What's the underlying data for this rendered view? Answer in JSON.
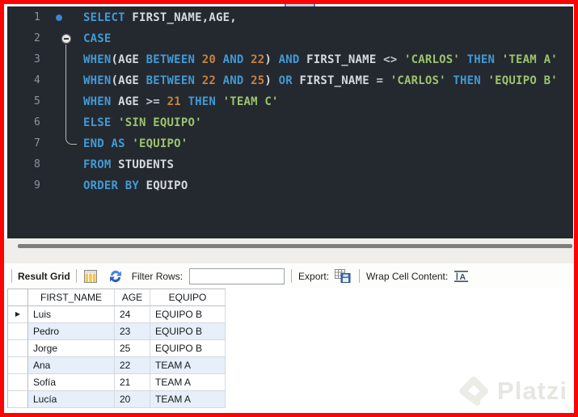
{
  "editor": {
    "background": "#24282f",
    "syntax_colors": {
      "k": "#419bd5",
      "i": "#d6dade",
      "n": "#c8823f",
      "s": "#9bc46d",
      "o": "#c2c8cf"
    },
    "lines": [
      {
        "num": "1",
        "marker": "statement",
        "tokens": [
          [
            "SELECT ",
            "k"
          ],
          [
            "FIRST_NAME,AGE,",
            "i"
          ]
        ]
      },
      {
        "num": "2",
        "marker": "fold",
        "tokens": [
          [
            "CASE",
            "k"
          ]
        ]
      },
      {
        "num": "3",
        "marker": "",
        "tokens": [
          [
            "WHEN",
            "k"
          ],
          [
            "(AGE ",
            "i"
          ],
          [
            "BETWEEN ",
            "k"
          ],
          [
            "20 ",
            "n"
          ],
          [
            "AND ",
            "k"
          ],
          [
            "22",
            "n"
          ],
          [
            ") ",
            "i"
          ],
          [
            "AND ",
            "k"
          ],
          [
            "FIRST_NAME ",
            "i"
          ],
          [
            "<> ",
            "o"
          ],
          [
            "'CARLOS' ",
            "s"
          ],
          [
            "THEN ",
            "k"
          ],
          [
            "'TEAM A'",
            "s"
          ]
        ]
      },
      {
        "num": "4",
        "marker": "",
        "tokens": [
          [
            "WHEN",
            "k"
          ],
          [
            "(AGE ",
            "i"
          ],
          [
            "BETWEEN ",
            "k"
          ],
          [
            "22 ",
            "n"
          ],
          [
            "AND ",
            "k"
          ],
          [
            "25",
            "n"
          ],
          [
            ") ",
            "i"
          ],
          [
            "OR ",
            "k"
          ],
          [
            "FIRST_NAME ",
            "i"
          ],
          [
            "= ",
            "o"
          ],
          [
            "'CARLOS' ",
            "s"
          ],
          [
            "THEN ",
            "k"
          ],
          [
            "'EQUIPO B'",
            "s"
          ]
        ]
      },
      {
        "num": "5",
        "marker": "",
        "tokens": [
          [
            "WHEN ",
            "k"
          ],
          [
            "AGE ",
            "i"
          ],
          [
            ">= ",
            "o"
          ],
          [
            "21 ",
            "n"
          ],
          [
            "THEN ",
            "k"
          ],
          [
            "'TEAM C'",
            "s"
          ]
        ]
      },
      {
        "num": "6",
        "marker": "",
        "tokens": [
          [
            "ELSE ",
            "k"
          ],
          [
            "'SIN EQUIPO'",
            "s"
          ]
        ]
      },
      {
        "num": "7",
        "marker": "",
        "tokens": [
          [
            "END AS ",
            "k"
          ],
          [
            "'EQUIPO'",
            "s"
          ]
        ]
      },
      {
        "num": "8",
        "marker": "",
        "tokens": [
          [
            "FROM ",
            "k"
          ],
          [
            "STUDENTS",
            "i"
          ]
        ]
      },
      {
        "num": "9",
        "marker": "",
        "tokens": [
          [
            "ORDER BY ",
            "k"
          ],
          [
            "EQUIPO",
            "i"
          ]
        ]
      }
    ]
  },
  "results_toolbar": {
    "result_grid_label": "Result Grid",
    "filter_rows_label": "Filter Rows:",
    "filter_input_value": "",
    "export_label": "Export:",
    "wrap_cell_label": "Wrap Cell Content:"
  },
  "result_table": {
    "headers": [
      "FIRST_NAME",
      "AGE",
      "EQUIPO"
    ],
    "rows": [
      [
        "Luis",
        "24",
        "EQUIPO B"
      ],
      [
        "Pedro",
        "23",
        "EQUIPO B"
      ],
      [
        "Jorge",
        "25",
        "EQUIPO B"
      ],
      [
        "Ana",
        "22",
        "TEAM A"
      ],
      [
        "Sofía",
        "21",
        "TEAM A"
      ],
      [
        "Lucía",
        "20",
        "TEAM A"
      ]
    ],
    "selected_row_marker": "▶"
  },
  "watermark": {
    "text": "Platzi"
  },
  "frame_color": "#fb0404"
}
